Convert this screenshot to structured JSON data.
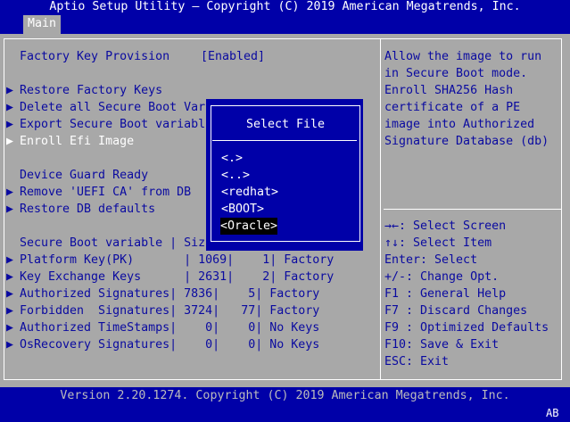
{
  "header": {
    "title": "Aptio Setup Utility – Copyright (C) 2019 American Megatrends, Inc.",
    "tab": "Main"
  },
  "menu": {
    "factory_key": {
      "label": "Factory Key Provision",
      "value": "[Enabled]"
    },
    "items": [
      {
        "label": "Restore Factory Keys"
      },
      {
        "label": "Delete all Secure Boot Var"
      },
      {
        "label": "Export Secure Boot variabl"
      },
      {
        "label": "Enroll Efi Image"
      }
    ],
    "device_guard": "Device Guard Ready",
    "dg_items": [
      {
        "label": "Remove 'UEFI CA' from DB"
      },
      {
        "label": "Restore DB defaults"
      }
    ],
    "table_header": "Secure Boot variable | Siz",
    "table_rows": [
      {
        "name": "Platform Key(PK)       ",
        "size": " 1069",
        "count": "    1",
        "source": " Factory"
      },
      {
        "name": "Key Exchange Keys      ",
        "size": " 2631",
        "count": "    2",
        "source": " Factory"
      },
      {
        "name": "Authorized Signatures",
        "size": " 7836",
        "count": "    5",
        "source": " Factory"
      },
      {
        "name": "Forbidden  Signatures",
        "size": " 3724",
        "count": "   77",
        "source": " Factory"
      },
      {
        "name": "Authorized TimeStamps",
        "size": "    0",
        "count": "    0",
        "source": " No Keys"
      },
      {
        "name": "OsRecovery Signatures",
        "size": "    0",
        "count": "    0",
        "source": " No Keys"
      }
    ]
  },
  "help": {
    "lines": [
      "Allow the image to run",
      "in Secure Boot mode.",
      "Enroll SHA256 Hash",
      "certificate of a PE",
      "image into Authorized",
      "Signature Database (db)"
    ],
    "keys": [
      "→←: Select Screen",
      "↑↓: Select Item",
      "Enter: Select",
      "+/-: Change Opt.",
      "F1 : General Help",
      "F7 : Discard Changes",
      "F9 : Optimized Defaults",
      "F10: Save & Exit",
      "ESC: Exit"
    ]
  },
  "dialog": {
    "title": "Select File",
    "options": [
      "<.>",
      "<..>",
      "<redhat>",
      "<BOOT>",
      "<Oracle>"
    ],
    "selected": "<Oracle>"
  },
  "footer": {
    "version": "Version 2.20.1274. Copyright (C) 2019 American Megatrends, Inc.",
    "badge": "AB"
  }
}
